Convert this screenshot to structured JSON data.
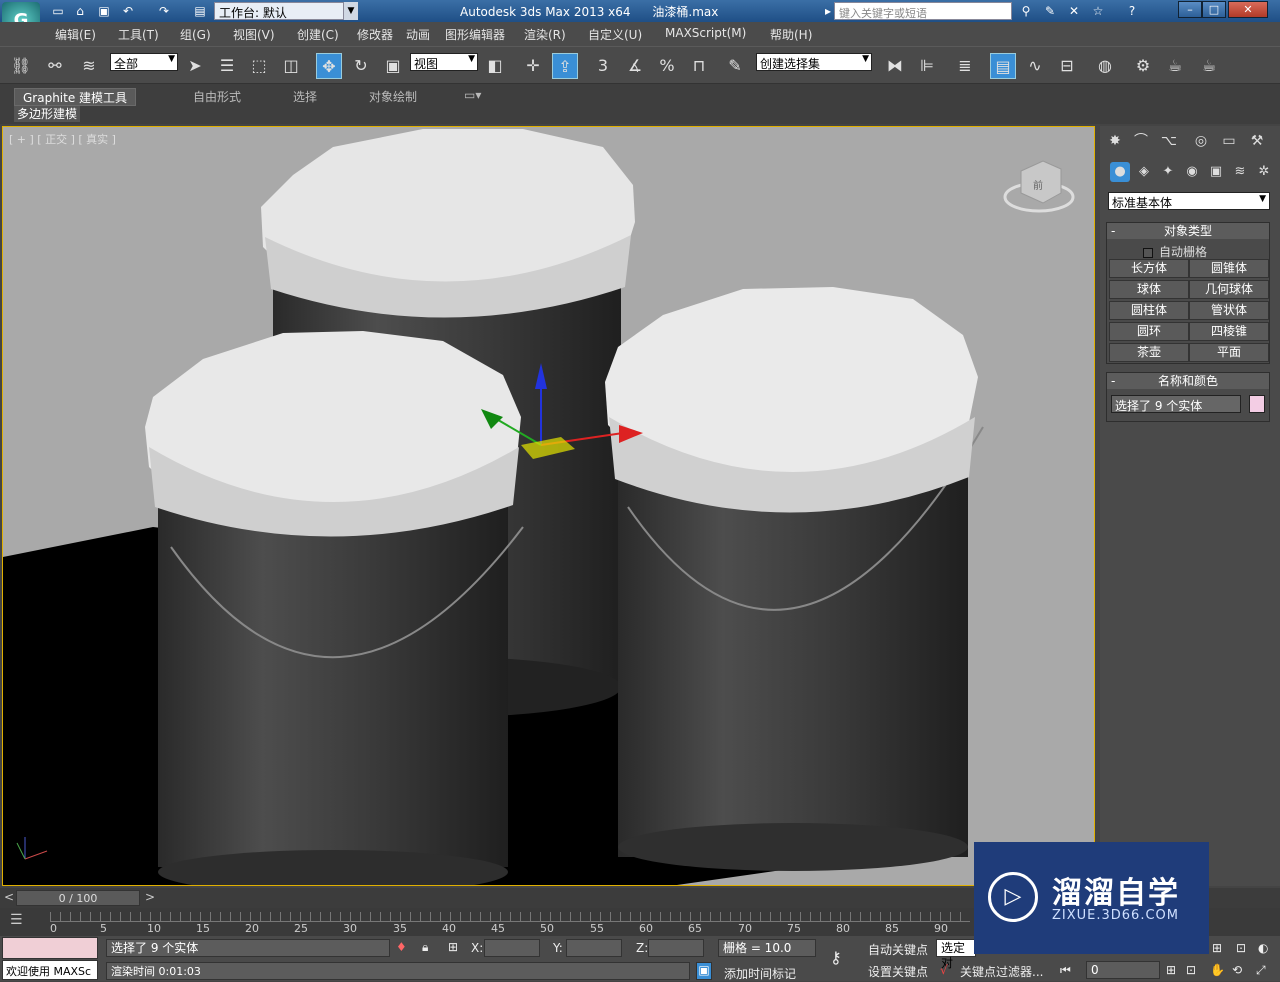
{
  "titlebar": {
    "workspace_label": "工作台: 默认",
    "app_title": "Autodesk 3ds Max  2013 x64",
    "file_name": "油漆桶.max",
    "search_placeholder": "键入关键字或短语"
  },
  "menu": [
    "编辑(E)",
    "工具(T)",
    "组(G)",
    "视图(V)",
    "创建(C)",
    "修改器",
    "动画",
    "图形编辑器",
    "渲染(R)",
    "自定义(U)",
    "MAXScript(M)",
    "帮助(H)"
  ],
  "toolbar": {
    "selection_filter": "全部",
    "reference_coord": "视图",
    "named_selection_set": "创建选择集",
    "snap_label": "3",
    "percent_label": "%"
  },
  "ribbon": {
    "tabs": [
      "Graphite 建模工具",
      "自由形式",
      "选择",
      "对象绘制"
    ],
    "sub_label": "多边形建模"
  },
  "viewport": {
    "label": "[ + ] [ 正交 ] [ 真实 ]",
    "viewcube_label": "前"
  },
  "command_panel": {
    "category": "标准基本体",
    "object_type_header": "对象类型",
    "auto_grid_label": "自动栅格",
    "buttons": [
      [
        "长方体",
        "圆锥体"
      ],
      [
        "球体",
        "几何球体"
      ],
      [
        "圆柱体",
        "管状体"
      ],
      [
        "圆环",
        "四棱锥"
      ],
      [
        "茶壶",
        "平面"
      ]
    ],
    "name_color_header": "名称和颜色",
    "name_value": "选择了 9 个实体",
    "object_color": "#f3cde4"
  },
  "timeline": {
    "frame_display": "0 / 100",
    "ticks": [
      "0",
      "5",
      "10",
      "15",
      "20",
      "25",
      "30",
      "35",
      "40",
      "45",
      "50",
      "55",
      "60",
      "65",
      "70",
      "75",
      "80",
      "85",
      "90"
    ]
  },
  "status": {
    "maxscript_label": "欢迎使用 MAXSc",
    "selection_status": "选择了 9 个实体",
    "render_time": "渲染时间  0:01:03",
    "x_label": "X:",
    "y_label": "Y:",
    "z_label": "Z:",
    "grid_label": "栅格 = 10.0",
    "auto_key": "自动关键点",
    "selected_dropdown": "选定对",
    "set_key": "设置关键点",
    "key_filters": "关键点过滤器...",
    "add_time_tag": "添加时间标记",
    "frame_value": "0"
  },
  "watermark": {
    "main": "溜溜自学",
    "sub": "ZIXUE.3D66.COM"
  }
}
